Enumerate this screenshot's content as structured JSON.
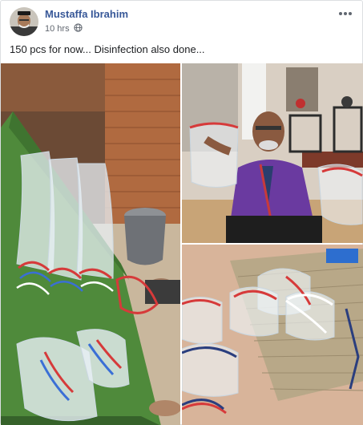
{
  "post": {
    "author": {
      "name": "Mustaffa Ibrahim",
      "avatar_icon": "profile-photo"
    },
    "timestamp": "10 hrs",
    "privacy_icon": "globe-icon",
    "more_icon": "more-options-icon",
    "text": "150 pcs for now... Disinfection also done..."
  },
  "photos": [
    {
      "id": "photo-1",
      "subject": "face shields stacked on green cot"
    },
    {
      "id": "photo-2",
      "subject": "man holding face shield near 3D printers"
    },
    {
      "id": "photo-3",
      "subject": "face shields on bamboo mat"
    }
  ],
  "colors": {
    "link": "#385898",
    "meta": "#616770",
    "text": "#1c1e21",
    "border": "#dddfe2"
  }
}
